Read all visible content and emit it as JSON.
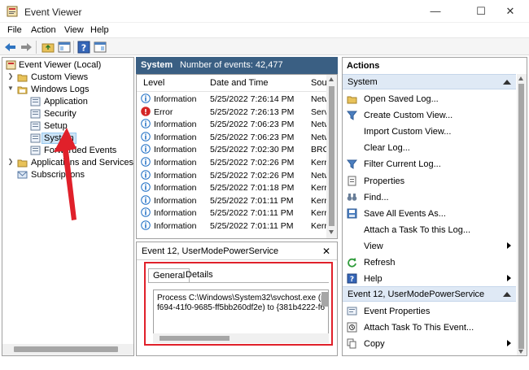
{
  "window": {
    "title": "Event Viewer",
    "minimize_glyph": "—",
    "maximize_glyph": "☐",
    "close_glyph": "✕"
  },
  "menu": [
    "File",
    "Action",
    "View",
    "Help"
  ],
  "tree": {
    "items": [
      {
        "label": "Event Viewer (Local)",
        "icon": "event-viewer-icon"
      },
      {
        "label": "Custom Views",
        "icon": "folder-icon"
      },
      {
        "label": "Windows Logs",
        "icon": "folder-open-icon"
      },
      {
        "label": "Application",
        "icon": "log-icon"
      },
      {
        "label": "Security",
        "icon": "log-icon"
      },
      {
        "label": "Setup",
        "icon": "log-icon"
      },
      {
        "label": "System",
        "icon": "log-icon"
      },
      {
        "label": "Forwarded Events",
        "icon": "log-icon"
      },
      {
        "label": "Applications and Services Logs",
        "icon": "folder-icon"
      },
      {
        "label": "Subscriptions",
        "icon": "subscriptions-icon"
      }
    ]
  },
  "center": {
    "log_name": "System",
    "event_count": "Number of events: 42,477",
    "columns": {
      "level": "Level",
      "date": "Date and Time",
      "source": "Sou"
    },
    "rows": [
      {
        "level": "Information",
        "date": "5/25/2022 7:26:14 PM",
        "source": "Netw"
      },
      {
        "level": "Error",
        "date": "5/25/2022 7:26:13 PM",
        "source": "Serv"
      },
      {
        "level": "Information",
        "date": "5/25/2022 7:06:23 PM",
        "source": "Netw"
      },
      {
        "level": "Information",
        "date": "5/25/2022 7:06:23 PM",
        "source": "Netw"
      },
      {
        "level": "Information",
        "date": "5/25/2022 7:02:30 PM",
        "source": "BRC"
      },
      {
        "level": "Information",
        "date": "5/25/2022 7:02:26 PM",
        "source": "Kerr"
      },
      {
        "level": "Information",
        "date": "5/25/2022 7:02:26 PM",
        "source": "Netw"
      },
      {
        "level": "Information",
        "date": "5/25/2022 7:01:18 PM",
        "source": "Kerr"
      },
      {
        "level": "Information",
        "date": "5/25/2022 7:01:11 PM",
        "source": "Kerr"
      },
      {
        "level": "Information",
        "date": "5/25/2022 7:01:11 PM",
        "source": "Kerr"
      },
      {
        "level": "Information",
        "date": "5/25/2022 7:01:11 PM",
        "source": "Kerr"
      }
    ]
  },
  "detail": {
    "title": "Event 12, UserModePowerService",
    "close_glyph": "✕",
    "tabs": [
      "General",
      "Details"
    ],
    "lines": [
      "Process C:\\Windows\\System32\\svchost.exe (p",
      "f694-41f0-9685-ff5bb260df2e) to {381b4222-f6"
    ]
  },
  "actions": {
    "title": "Actions",
    "sections": [
      {
        "label": "System",
        "items": [
          {
            "label": "Open Saved Log...",
            "icon": "open-folder-icon"
          },
          {
            "label": "Create Custom View...",
            "icon": "filter-icon"
          },
          {
            "label": "Import Custom View...",
            "icon": "blank-icon"
          },
          {
            "label": "Clear Log...",
            "icon": "blank-icon"
          },
          {
            "label": "Filter Current Log...",
            "icon": "filter-icon"
          },
          {
            "label": "Properties",
            "icon": "properties-icon"
          },
          {
            "label": "Find...",
            "icon": "binoculars-icon"
          },
          {
            "label": "Save All Events As...",
            "icon": "save-icon"
          },
          {
            "label": "Attach a Task To this Log...",
            "icon": "blank-icon"
          },
          {
            "label": "View",
            "icon": "blank-icon",
            "submenu": true
          },
          {
            "label": "Refresh",
            "icon": "refresh-icon"
          },
          {
            "label": "Help",
            "icon": "help-icon",
            "submenu": true
          }
        ]
      },
      {
        "label": "Event 12, UserModePowerService",
        "items": [
          {
            "label": "Event Properties",
            "icon": "event-properties-icon"
          },
          {
            "label": "Attach Task To This Event...",
            "icon": "attach-task-icon"
          },
          {
            "label": "Copy",
            "icon": "copy-icon",
            "submenu": true
          }
        ]
      }
    ]
  },
  "colors": {
    "header_bg": "#3a5f83",
    "section_bg": "#dfe9f5",
    "selection": "#cce4f7",
    "info_icon": "#1f6fc5",
    "error_icon": "#d42525",
    "annotation_red": "#e0202a"
  }
}
